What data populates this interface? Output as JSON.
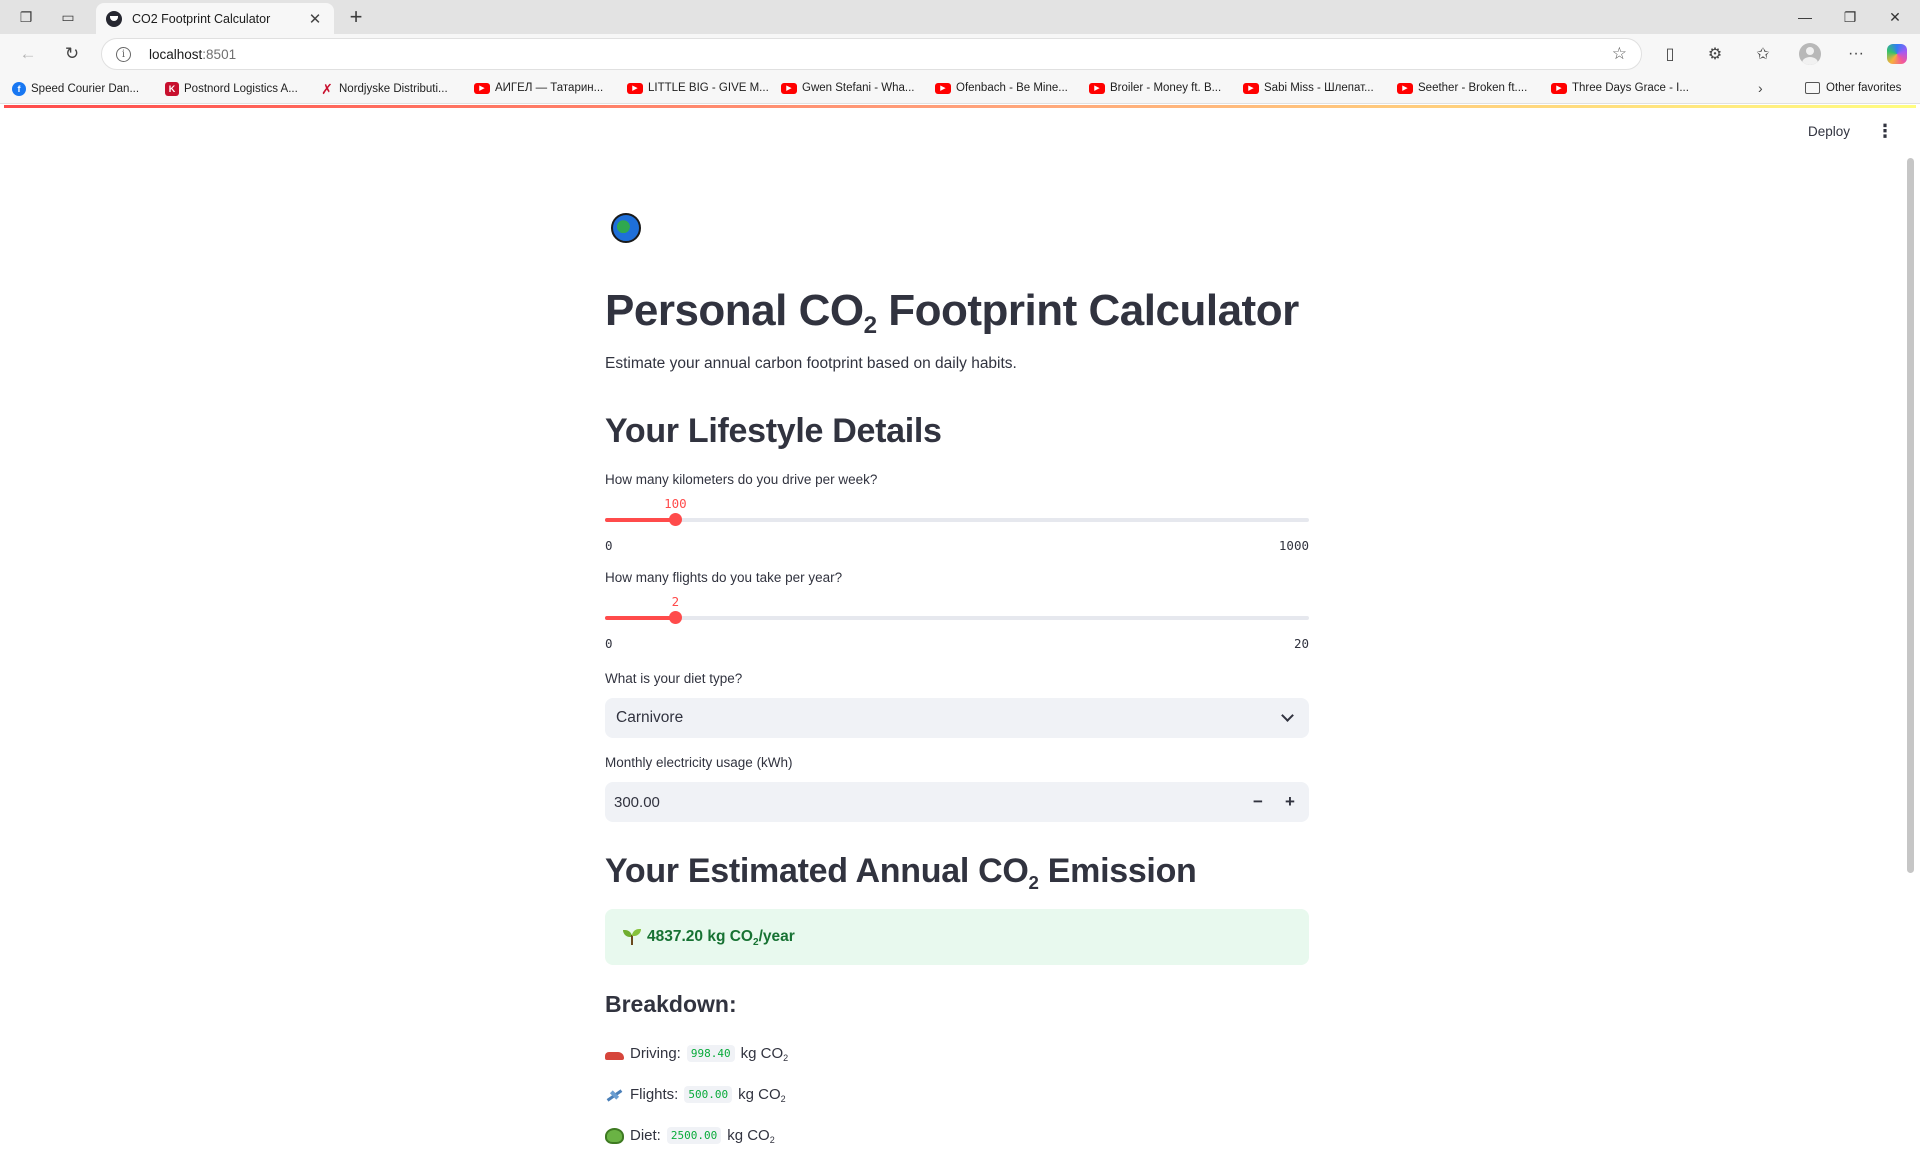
{
  "browser": {
    "tab_title": "CO2 Footprint Calculator",
    "url_host": "localhost",
    "url_port": ":8501",
    "bookmarks": [
      {
        "label": "Speed Courier Dan...",
        "icon": "facebook-icon"
      },
      {
        "label": "Postnord Logistics A...",
        "icon": "k-icon"
      },
      {
        "label": "Nordjyske Distributi...",
        "icon": "nd-icon"
      },
      {
        "label": "АИГЕЛ — Татарин...",
        "icon": "youtube-icon"
      },
      {
        "label": "LITTLE BIG - GIVE M...",
        "icon": "youtube-icon"
      },
      {
        "label": "Gwen Stefani - Wha...",
        "icon": "youtube-icon"
      },
      {
        "label": "Ofenbach - Be Mine...",
        "icon": "youtube-icon"
      },
      {
        "label": "Broiler - Money ft. B...",
        "icon": "youtube-icon"
      },
      {
        "label": "Sabi Miss - Шлепат...",
        "icon": "youtube-icon"
      },
      {
        "label": "Seether - Broken ft....",
        "icon": "youtube-icon"
      },
      {
        "label": "Three Days Grace - I...",
        "icon": "youtube-icon"
      }
    ],
    "other_favorites": "Other favorites"
  },
  "app": {
    "deploy_label": "Deploy",
    "title_prefix": "Personal CO",
    "title_sub": "2",
    "title_suffix": " Footprint Calculator",
    "caption": "Estimate your annual carbon footprint based on daily habits.",
    "section_lifestyle": "Your Lifestyle Details",
    "drive": {
      "label": "How many kilometers do you drive per week?",
      "value": 100,
      "min": 0,
      "max": 1000,
      "value_text": "100",
      "min_text": "0",
      "max_text": "1000"
    },
    "flights": {
      "label": "How many flights do you take per year?",
      "value": 2,
      "min": 0,
      "max": 20,
      "value_text": "2",
      "min_text": "0",
      "max_text": "20"
    },
    "diet": {
      "label": "What is your diet type?",
      "selected": "Carnivore"
    },
    "electricity": {
      "label": "Monthly electricity usage (kWh)",
      "value": "300.00",
      "minus": "−",
      "plus": "+"
    },
    "section_result_prefix": "Your Estimated Annual CO",
    "section_result_sub": "2",
    "section_result_suffix": " Emission",
    "result_value": "4837.20 kg CO",
    "result_sub": "2",
    "result_unit": "/year",
    "breakdown_title": "Breakdown:",
    "breakdown": [
      {
        "label": "Driving:",
        "value": "998.40",
        "unit": "kg CO",
        "unit_sub": "2",
        "icon": "car-icon"
      },
      {
        "label": "Flights:",
        "value": "500.00",
        "unit": "kg CO",
        "unit_sub": "2",
        "icon": "airplane-icon"
      },
      {
        "label": "Diet:",
        "value": "2500.00",
        "unit": "kg CO",
        "unit_sub": "2",
        "icon": "salad-icon"
      }
    ]
  },
  "colors": {
    "accent": "#ff4b4b",
    "success_bg": "#e8f9ee",
    "success_text": "#177233",
    "code_green": "#09ab3b"
  }
}
